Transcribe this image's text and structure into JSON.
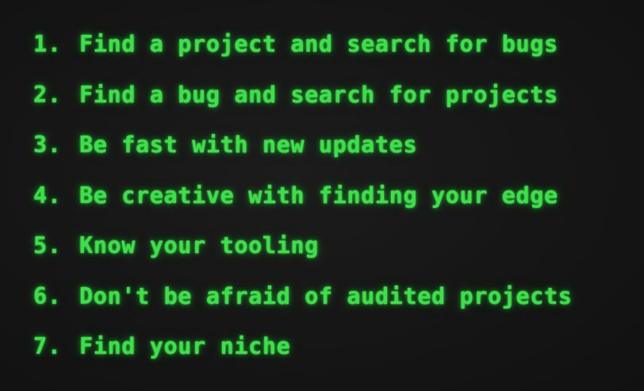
{
  "items": [
    {
      "num": "1.",
      "text": "Find a project and search for bugs"
    },
    {
      "num": "2.",
      "text": "Find a bug and search for projects"
    },
    {
      "num": "3.",
      "text": "Be fast with new updates"
    },
    {
      "num": "4.",
      "text": "Be creative with finding your edge"
    },
    {
      "num": "5.",
      "text": "Know your tooling"
    },
    {
      "num": "6.",
      "text": "Don't be afraid of audited projects"
    },
    {
      "num": "7.",
      "text": "Find your niche"
    }
  ],
  "colors": {
    "text": "#3ee04a",
    "background": "#161616"
  }
}
